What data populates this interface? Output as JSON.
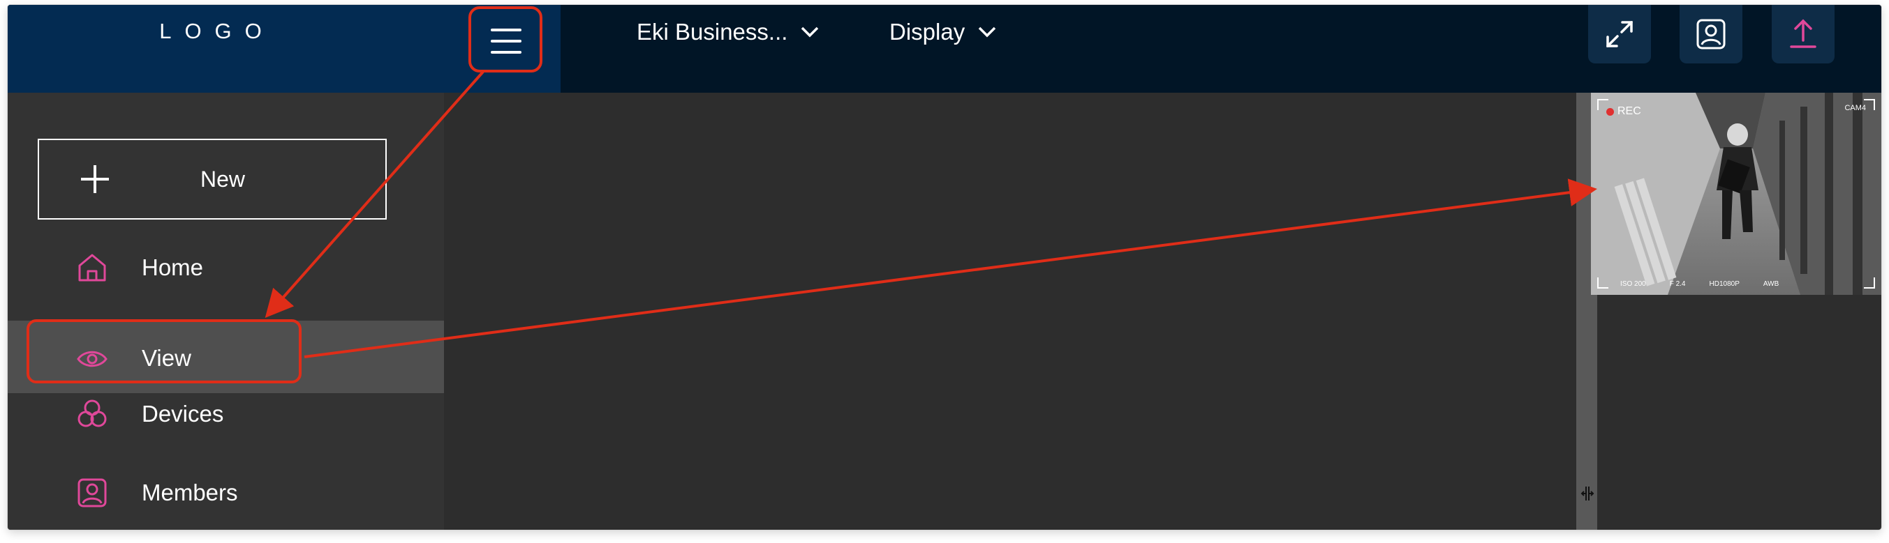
{
  "header": {
    "logo": "LOGO",
    "business_dropdown": "Eki Business...",
    "display_dropdown": "Display"
  },
  "sidebar": {
    "new_button": "New",
    "items": [
      {
        "label": "Home",
        "icon": "home-icon"
      },
      {
        "label": "View",
        "icon": "eye-icon",
        "selected": true
      },
      {
        "label": "Devices",
        "icon": "devices-icon"
      },
      {
        "label": "Members",
        "icon": "members-icon"
      }
    ]
  },
  "camera": {
    "rec_label": "REC",
    "cam_id": "CAM4",
    "osd": [
      "ISO 200",
      "F 2.4",
      "HD1080P",
      "AWB"
    ]
  },
  "colors": {
    "accent": "#e0489a",
    "annotation": "#e02d18",
    "header_bg": "#011526",
    "logo_bg": "#032b52",
    "sidebar_bg": "#333333",
    "content_bg": "#2d2d2d"
  }
}
